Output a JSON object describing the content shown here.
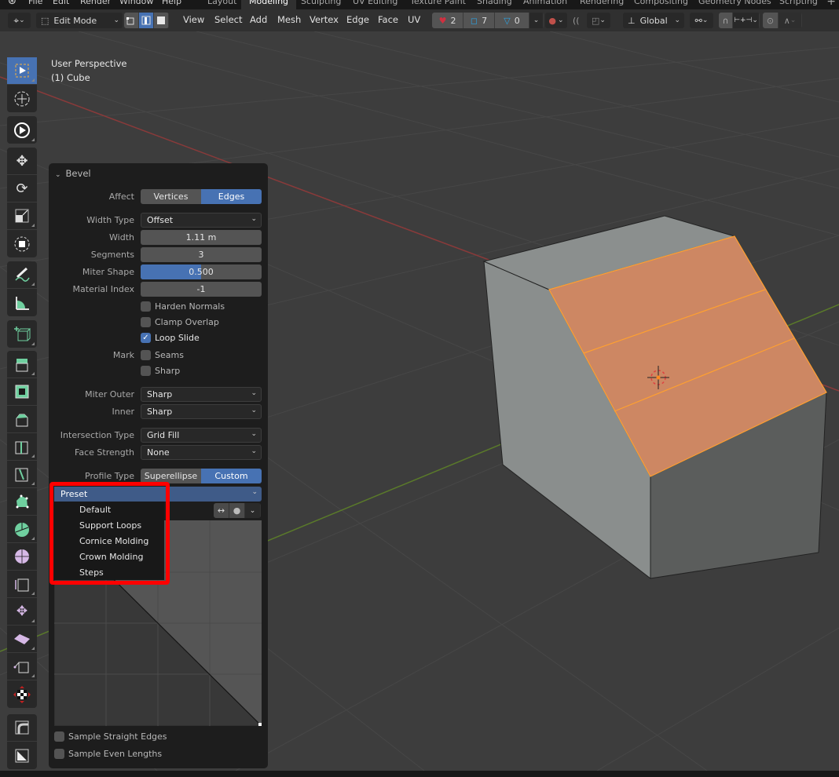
{
  "topbar": {
    "menus": [
      "File",
      "Edit",
      "Render",
      "Window",
      "Help"
    ],
    "workspaces": [
      "Layout",
      "Modeling",
      "Sculpting",
      "UV Editing",
      "Texture Paint",
      "Shading",
      "Animation",
      "Rendering",
      "Compositing",
      "Geometry Nodes",
      "Scripting"
    ],
    "active_workspace": "Modeling",
    "add_workspace": "+"
  },
  "header": {
    "mode": "Edit Mode",
    "menus": [
      "View",
      "Select",
      "Add",
      "Mesh",
      "Vertex",
      "Edge",
      "Face",
      "UV"
    ],
    "overlay_counts": {
      "gizmo": "2",
      "edges": "7",
      "faces": "0"
    },
    "transform_orientation": "Global",
    "select_mode_active": "edge"
  },
  "viewport": {
    "view_name": "User Perspective",
    "object_name": "(1) Cube"
  },
  "toolbar": {
    "tools": [
      "select-box",
      "cursor",
      "tweak",
      "move",
      "rotate",
      "scale",
      "transform",
      "annotate",
      "measure",
      "add-cube",
      "extrude-region",
      "inset-faces",
      "bevel",
      "loop-cut",
      "knife",
      "poly-build",
      "spin",
      "smooth",
      "edge-slide",
      "shrink-fatten",
      "shear",
      "rip-region",
      "to-sphere",
      "custom-tool-1",
      "custom-tool-2"
    ],
    "active_tool": "select-box"
  },
  "bevel_panel": {
    "title": "Bevel",
    "affect": {
      "label": "Affect",
      "options": [
        "Vertices",
        "Edges"
      ],
      "selected": "Edges"
    },
    "width_type": {
      "label": "Width Type",
      "value": "Offset"
    },
    "width": {
      "label": "Width",
      "value": "1.11 m"
    },
    "segments": {
      "label": "Segments",
      "value": "3"
    },
    "miter_shape": {
      "label": "Miter Shape",
      "value": "0.500",
      "fraction": 0.5
    },
    "material_index": {
      "label": "Material Index",
      "value": "-1"
    },
    "harden_normals": {
      "label": "Harden Normals",
      "checked": false
    },
    "clamp_overlap": {
      "label": "Clamp Overlap",
      "checked": false
    },
    "loop_slide": {
      "label": "Loop Slide",
      "checked": true
    },
    "mark": {
      "label": "Mark",
      "seams": "Seams",
      "sharp": "Sharp"
    },
    "miter_outer": {
      "label": "Miter Outer",
      "value": "Sharp"
    },
    "inner": {
      "label": "Inner",
      "value": "Sharp"
    },
    "intersection_type": {
      "label": "Intersection Type",
      "value": "Grid Fill"
    },
    "face_strength": {
      "label": "Face Strength",
      "value": "None"
    },
    "profile_type": {
      "label": "Profile Type",
      "options": [
        "Superellipse",
        "Custom"
      ],
      "selected": "Custom"
    },
    "sample_straight_edges": {
      "label": "Sample Straight Edges",
      "checked": false
    },
    "sample_even_lengths": {
      "label": "Sample Even Lengths",
      "checked": false
    }
  },
  "preset_menu": {
    "title": "Preset",
    "items": [
      "Default",
      "Support Loops",
      "Cornice Molding",
      "Crown Molding",
      "Steps"
    ]
  },
  "colors": {
    "accent": "#4772b3",
    "highlight_box": "#ff0000",
    "selected_face": "#cd8763",
    "selected_edge": "#ffa030"
  }
}
